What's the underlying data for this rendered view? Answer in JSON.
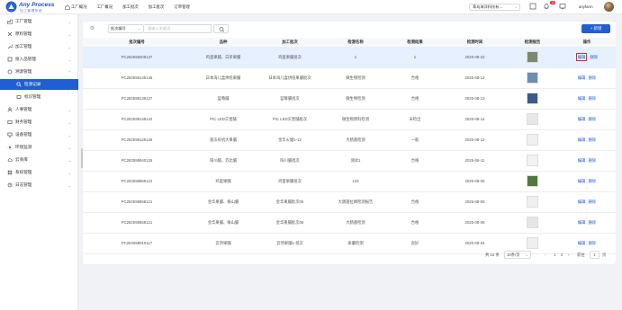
{
  "header": {
    "brand_title": "Any Process",
    "brand_sub": "加工管理系统",
    "nav": [
      "工厂概况",
      "工厂概况",
      "加工批次",
      "加工批次",
      "订单管理"
    ],
    "factory": "青岛海洋科技有…",
    "notif_count": "12",
    "user": "anyfarm"
  },
  "sidebar": {
    "items": [
      {
        "label": "工厂管理",
        "icon": "factory-icon"
      },
      {
        "label": "原料管理",
        "icon": "material-icon"
      },
      {
        "label": "加工管理",
        "icon": "wrench-icon"
      },
      {
        "label": "投入品管理",
        "icon": "input-goods-icon"
      },
      {
        "label": "溯源管理",
        "icon": "trace-icon"
      },
      {
        "label": "检测记录",
        "icon": "search-icon"
      },
      {
        "label": "标识管理",
        "icon": "label-icon"
      },
      {
        "label": "人事管理",
        "icon": "person-icon"
      },
      {
        "label": "财务管理",
        "icon": "finance-icon"
      },
      {
        "label": "设备管理",
        "icon": "device-icon"
      },
      {
        "label": "环境监测",
        "icon": "environment-icon"
      },
      {
        "label": "云商库",
        "icon": "cloud-store-icon"
      },
      {
        "label": "系统管理",
        "icon": "system-icon"
      },
      {
        "label": "日志管理",
        "icon": "log-icon"
      }
    ]
  },
  "toolbar": {
    "field_select": "批次编号",
    "keyword_placeholder": "请输入关键词",
    "add_label": "+ 新增"
  },
  "table": {
    "columns": [
      "批次编号",
      "品种",
      "加工批次",
      "检测名称",
      "检测结果",
      "检测时间",
      "检测报告",
      "操作"
    ],
    "rows": [
      {
        "id": "PC282596009147",
        "variety": "鸡蛋果脯、白茶果脯",
        "batch": "鸡蛋果脯批次",
        "name": "1",
        "result": "1",
        "date": "2025-08-22",
        "report": "#7b8a6a",
        "selected": true
      },
      {
        "id": "PC282598145145",
        "variety": "日本海儿盒烘焙果脯",
        "batch": "日本海儿盒烘焙果脯批次",
        "name": "微生物检测",
        "result": "合格",
        "date": "2025-08-12",
        "report": "#6a8fb5",
        "selected": false
      },
      {
        "id": "PC282598138137",
        "variety": "蓝莓脯",
        "batch": "蓝莓脯批次",
        "name": "微生物检测",
        "result": "合格",
        "date": "2025-08-13",
        "report": "#3a5a8a",
        "selected": false
      },
      {
        "id": "PC282598148142",
        "variety": "PIC LED灾害脯",
        "batch": "PIC LED灾害脯批次",
        "name": "微生物原料检测",
        "result": "未检出",
        "date": "2025-08-14",
        "report": "#e8e8e8",
        "selected": false
      },
      {
        "id": "PC282598128136",
        "variety": "速冻有机大果脯",
        "batch": "金华火腿1-12",
        "name": "大肠菌检测",
        "result": "一般",
        "date": "2025-08-12",
        "report": "#f0f0f0",
        "selected": false
      },
      {
        "id": "PC282598940125",
        "variety": "阳川脯、苏北脯",
        "batch": "阳川脯批次",
        "name": "测试1",
        "result": "合格",
        "date": "2025-08-11",
        "report": "#f2f2f2",
        "selected": false
      },
      {
        "id": "PC282598869122",
        "variety": "鸡蛋果脯",
        "batch": "鸡蛋果脯批次",
        "name": "123",
        "result": "",
        "date": "2025-08-05",
        "report": "#4f7a3a",
        "selected": false
      },
      {
        "id": "PC282598858121",
        "variety": "金华果脯、梅山脯",
        "batch": "金华果脯批次05",
        "name": "大肠菌拉姆检测报告",
        "result": "合格",
        "date": "2025-08-05",
        "report": "#f0f0f0",
        "selected": false
      },
      {
        "id": "PC282598858121",
        "variety": "金华果脯、梅山脯",
        "batch": "金华果脯批次05",
        "name": "大肠菌检测",
        "result": "合格",
        "date": "2025-08-06",
        "report": "#e6e6e6",
        "selected": false
      },
      {
        "id": "PC282598910117",
        "variety": "云然果脯",
        "batch": "云然果脯1-批次",
        "name": "质量检测",
        "result": "良好",
        "date": "2025-08-04",
        "report": "#efefef",
        "selected": false
      }
    ],
    "edit_label": "编辑",
    "delete_label": "删除"
  },
  "pager": {
    "total": "共 15 条",
    "size": "10条/页",
    "pages": [
      "1",
      "2"
    ],
    "goto_label": "前往",
    "goto_value": "1",
    "page_suffix": "页"
  }
}
